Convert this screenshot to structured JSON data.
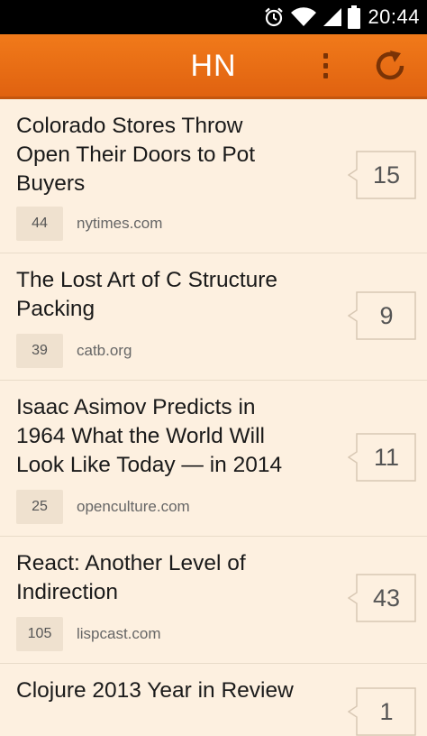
{
  "status_bar": {
    "time": "20:44",
    "icons": [
      "alarm-icon",
      "wifi-icon",
      "signal-icon",
      "battery-icon"
    ]
  },
  "app_bar": {
    "title": "HN",
    "menu_icon": "overflow-menu-icon",
    "refresh_icon": "refresh-icon"
  },
  "colors": {
    "accent": "#ec6f15",
    "background": "#fdf0e0",
    "badge": "#efe1cf"
  },
  "stories": [
    {
      "title_lines": [
        "Colorado Stores Throw",
        "Open Their Doors to Pot",
        "Buyers"
      ],
      "points": "44",
      "domain": "nytimes.com",
      "comments": "15"
    },
    {
      "title_lines": [
        "The Lost Art of C Structure",
        "Packing"
      ],
      "points": "39",
      "domain": "catb.org",
      "comments": "9"
    },
    {
      "title_lines": [
        "Isaac Asimov Predicts in",
        "1964 What the World Will",
        "Look Like Today — in 2014"
      ],
      "points": "25",
      "domain": "openculture.com",
      "comments": "11"
    },
    {
      "title_lines": [
        "React: Another Level of",
        "Indirection"
      ],
      "points": "105",
      "domain": "lispcast.com",
      "comments": "43"
    },
    {
      "title_lines": [
        "Clojure 2013 Year in Review"
      ],
      "points": "",
      "domain": "",
      "comments": "1"
    }
  ]
}
